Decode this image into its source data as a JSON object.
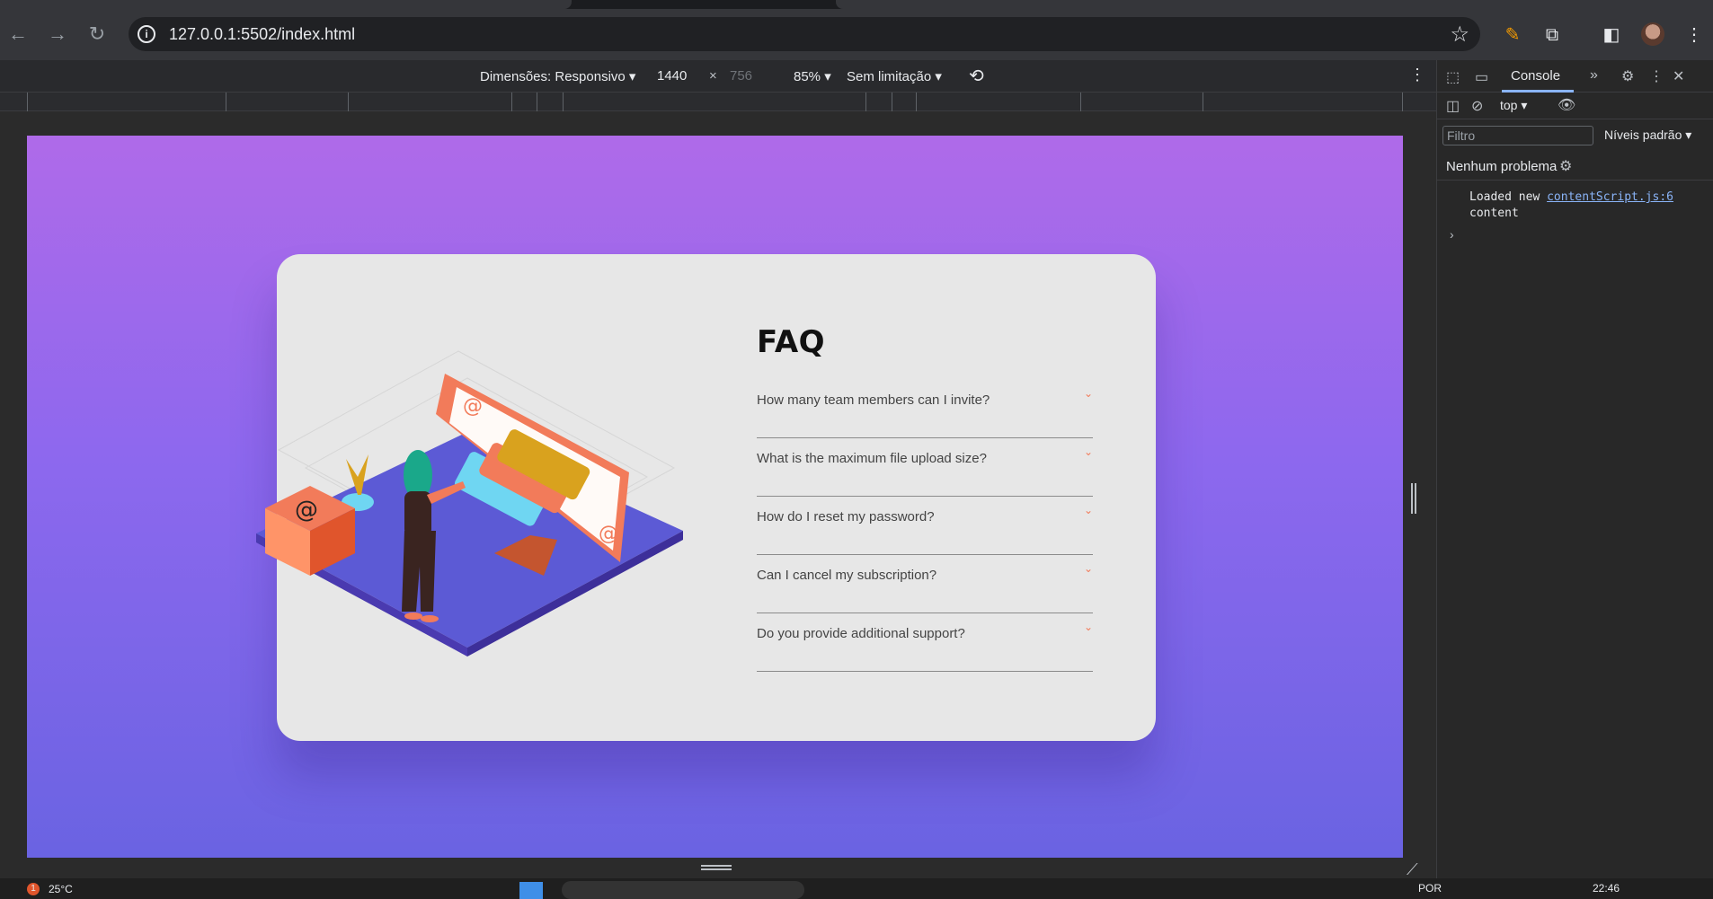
{
  "browser": {
    "url": "127.0.0.1:5502/index.html"
  },
  "device_toolbar": {
    "dimensions_label": "Dimensões: Responsivo",
    "width": "1440",
    "times": "×",
    "height": "756",
    "zoom": "85%",
    "throttle": "Sem limitação"
  },
  "faq": {
    "title": "FAQ",
    "items": [
      {
        "question": "How many team members can I invite?"
      },
      {
        "question": "What is the maximum file upload size?"
      },
      {
        "question": "How do I reset my password?"
      },
      {
        "question": "Can I cancel my subscription?"
      },
      {
        "question": "Do you provide additional support?"
      }
    ]
  },
  "devtools": {
    "tab": "Console",
    "context": "top",
    "filter_placeholder": "Filtro",
    "levels": "Níveis padrão",
    "issues": "Nenhum problema",
    "log_text": "Loaded new",
    "log_link": "contentScript.js:6",
    "log_text2": "content"
  },
  "taskbar": {
    "weather": "25°C",
    "notif_count": "1",
    "lang": "POR",
    "time": "22:46"
  },
  "colors": {
    "accent": "#f27b5a",
    "gradient_top": "#af6ae9",
    "gradient_bottom": "#6a63e2",
    "card": "#e7e7e7"
  }
}
